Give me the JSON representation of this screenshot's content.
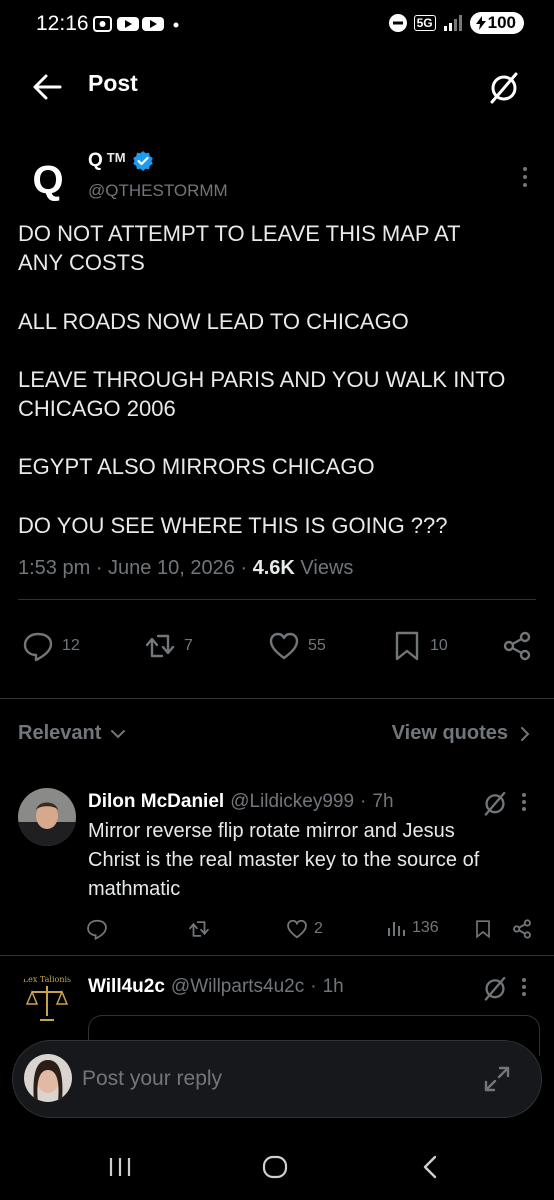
{
  "status_bar": {
    "time": "12:16",
    "network": "5G",
    "battery": "100"
  },
  "header": {
    "title": "Post",
    "back_icon": "arrow-left-icon",
    "grok_icon": "grok-icon"
  },
  "post": {
    "avatar_letter": "Q",
    "author_name": "Q",
    "author_tm": "TM",
    "verified": true,
    "handle": "@QTHESTORMM",
    "lines": [
      "DO NOT ATTEMPT TO LEAVE THIS MAP AT",
      "ANY COSTS",
      "ALL ROADS NOW LEAD TO CHICAGO",
      "LEAVE THROUGH PARIS AND YOU WALK INTO",
      "CHICAGO 2006",
      "EGYPT ALSO MIRRORS CHICAGO",
      "DO YOU SEE WHERE THIS IS GOING ???"
    ],
    "time": "1:53 pm",
    "date": "June 10, 2026",
    "views_count": "4.6K",
    "views_label": "Views",
    "actions": {
      "replies": "12",
      "reposts": "7",
      "likes": "55",
      "bookmarks": "10"
    }
  },
  "replies_section": {
    "sort_label": "Relevant",
    "view_quotes_label": "View quotes"
  },
  "replies": [
    {
      "name": "Dilon McDaniel",
      "handle": "@Lildickey999",
      "time": "7h",
      "text_lines": [
        "Mirror reverse flip rotate mirror and Jesus",
        "Christ is the real master key to the source of",
        "mathmatic"
      ],
      "likes": "2",
      "views": "136"
    },
    {
      "name": "Will4u2c",
      "handle": "@Willparts4u2c",
      "time": "1h",
      "avatar_text": "Lex Talionis"
    }
  ],
  "compose": {
    "placeholder": "Post your reply"
  },
  "colors": {
    "background": "#000000",
    "text": "#e7e9ea",
    "muted": "#71767b",
    "verified": "#1d9bf0",
    "divider": "#2f3336"
  }
}
